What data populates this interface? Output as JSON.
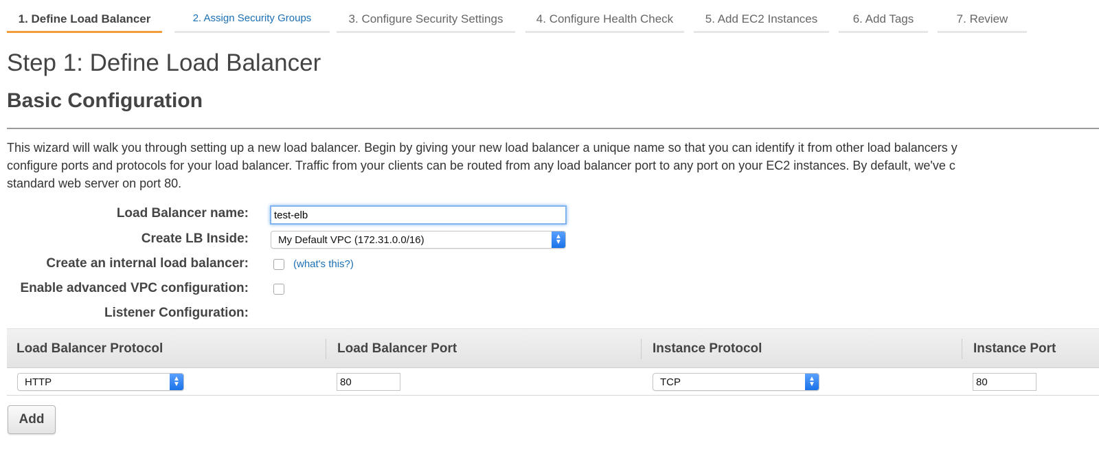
{
  "wizard": {
    "tabs": [
      {
        "label": "1. Define Load Balancer",
        "state": "active"
      },
      {
        "label": "2. Assign Security Groups",
        "state": "link"
      },
      {
        "label": "3. Configure Security Settings",
        "state": "inactive"
      },
      {
        "label": "4. Configure Health Check",
        "state": "inactive"
      },
      {
        "label": "5. Add EC2 Instances",
        "state": "inactive"
      },
      {
        "label": "6. Add Tags",
        "state": "inactive"
      },
      {
        "label": "7. Review",
        "state": "inactive"
      }
    ],
    "active_color": "#f29d38",
    "link_color": "#1a6fb5"
  },
  "page": {
    "step_title": "Step 1: Define Load Balancer",
    "section_title": "Basic Configuration",
    "intro_lines": [
      "This wizard will walk you through setting up a new load balancer. Begin by giving your new load balancer a unique name so that you can identify it from other load balancers y",
      "configure ports and protocols for your load balancer. Traffic from your clients can be routed from any load balancer port to any port on your EC2 instances. By default, we've c",
      "standard web server on port 80."
    ]
  },
  "form": {
    "name_label": "Load Balancer name:",
    "name_value": "test-elb",
    "vpc_label": "Create LB Inside:",
    "vpc_value": "My Default VPC (172.31.0.0/16)",
    "internal_label": "Create an internal load balancer:",
    "internal_checked": false,
    "whats_this": "(what's this?)",
    "advanced_label": "Enable advanced VPC configuration:",
    "advanced_checked": false,
    "listener_label": "Listener Configuration:"
  },
  "listeners": {
    "headers": [
      "Load Balancer Protocol",
      "Load Balancer Port",
      "Instance Protocol",
      "Instance Port"
    ],
    "rows": [
      {
        "lb_protocol": "HTTP",
        "lb_port": "80",
        "instance_protocol": "TCP",
        "instance_port": "80"
      }
    ],
    "add_label": "Add"
  },
  "icons": {
    "select_arrow": "chevron-updown-icon"
  }
}
